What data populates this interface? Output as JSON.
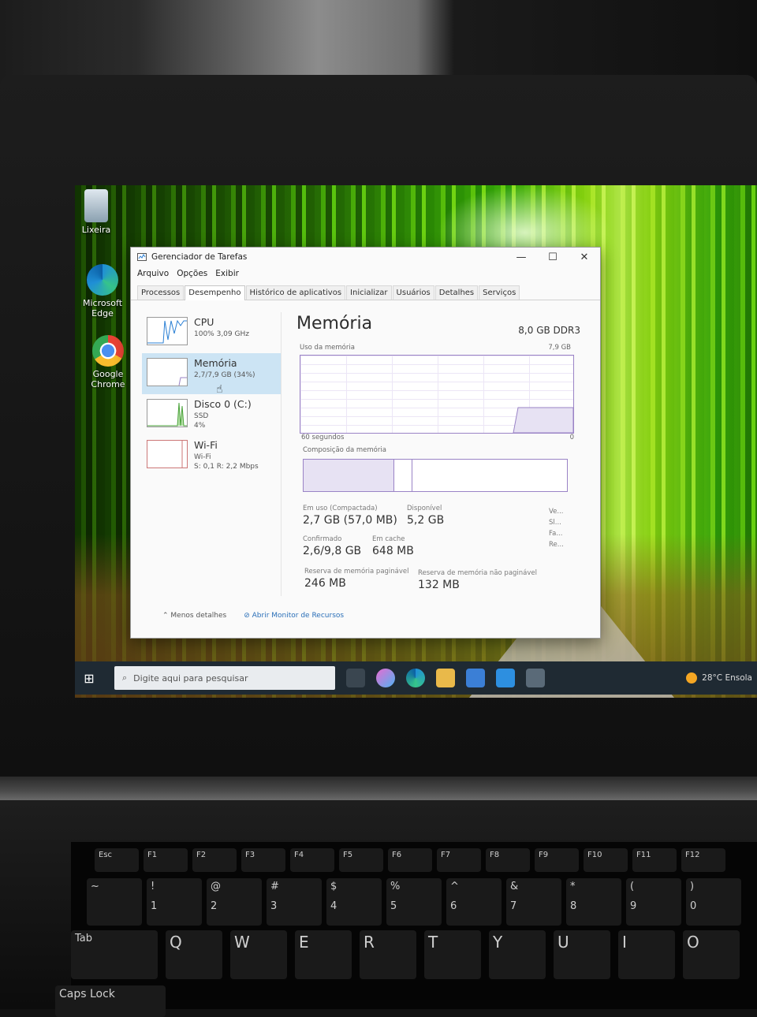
{
  "desktop": {
    "icons": [
      {
        "label": "Lixeira",
        "icon": "recycle-bin-icon"
      },
      {
        "label": "Microsoft Edge",
        "icon": "edge-icon"
      },
      {
        "label": "Google Chrome",
        "icon": "chrome-icon"
      }
    ]
  },
  "window": {
    "title": "Gerenciador de Tarefas",
    "controls": {
      "minimize": "—",
      "maximize": "☐",
      "close": "✕"
    },
    "menu": [
      "Arquivo",
      "Opções",
      "Exibir"
    ],
    "tabs": [
      "Processos",
      "Desempenho",
      "Histórico de aplicativos",
      "Inicializar",
      "Usuários",
      "Detalhes",
      "Serviços"
    ],
    "active_tab": "Desempenho"
  },
  "sidebar": [
    {
      "name": "CPU",
      "sub1": "100% 3,09 GHz",
      "sub2": "",
      "selected": false
    },
    {
      "name": "Memória",
      "sub1": "2,7/7,9 GB (34%)",
      "sub2": "",
      "selected": true
    },
    {
      "name": "Disco 0 (C:)",
      "sub1": "SSD",
      "sub2": "4%",
      "selected": false
    },
    {
      "name": "Wi-Fi",
      "sub1": "Wi-Fi",
      "sub2": "S: 0,1 R: 2,2 Mbps",
      "selected": false
    }
  ],
  "memory": {
    "title": "Memória",
    "spec": "8,0 GB DDR3",
    "usage_label": "Uso da memória",
    "max_label": "7,9 GB",
    "time_label": "60 segundos",
    "zero_label": "0",
    "composition_label": "Composição da memória",
    "composition": {
      "in_use_fraction": 0.34,
      "modified_fraction": 0.01
    },
    "stats": {
      "in_use": {
        "label": "Em uso (Compactada)",
        "value": "2,7 GB (57,0 MB)"
      },
      "available": {
        "label": "Disponível",
        "value": "5,2 GB"
      },
      "committed": {
        "label": "Confirmado",
        "value": "2,6/9,8 GB"
      },
      "cached": {
        "label": "Em cache",
        "value": "648 MB"
      },
      "paged": {
        "label": "Reserva de memória paginável",
        "value": "246 MB"
      },
      "nonpaged": {
        "label": "Reserva de memória não paginável",
        "value": "132 MB"
      }
    },
    "right_labels": [
      "Ve...",
      "Sl...",
      "Fa...",
      "Re..."
    ]
  },
  "footer": {
    "less_details": "Menos detalhes",
    "resource_monitor": "Abrir Monitor de Recursos"
  },
  "taskbar": {
    "search_placeholder": "Digite aqui para pesquisar",
    "weather": "28°C Ensola"
  },
  "keyboard": {
    "fn_row": [
      "Esc",
      "F1",
      "F2",
      "F3",
      "F4",
      "F5",
      "F6",
      "F7",
      "F8",
      "F9",
      "F10",
      "F11",
      "F12"
    ],
    "num_row": [
      [
        "~",
        ""
      ],
      [
        "!",
        "1"
      ],
      [
        "@",
        "2"
      ],
      [
        "#",
        "3"
      ],
      [
        "$",
        "4"
      ],
      [
        "%",
        "5"
      ],
      [
        "^",
        "6"
      ],
      [
        "&",
        "7"
      ],
      [
        "*",
        "8"
      ],
      [
        "(",
        "9"
      ],
      [
        ")",
        "0"
      ]
    ],
    "q_row": [
      "Tab",
      "Q",
      "W",
      "E",
      "R",
      "T",
      "Y",
      "U",
      "I",
      "O"
    ],
    "caps": "Caps Lock"
  },
  "colors": {
    "accent": "#9a83c6",
    "selected": "#cce4f4",
    "taskbar": "#1f2a33"
  }
}
